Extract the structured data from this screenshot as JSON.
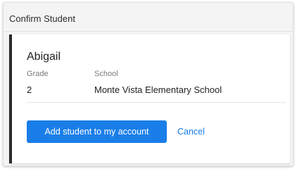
{
  "dialog": {
    "title": "Confirm Student"
  },
  "student": {
    "name": "Abigail",
    "grade_label": "Grade",
    "grade_value": "2",
    "school_label": "School",
    "school_value": "Monte Vista Elementary School"
  },
  "actions": {
    "add_label": "Add student to my account",
    "cancel_label": "Cancel"
  },
  "colors": {
    "accent": "#1a7ee8",
    "card_border": "#2a2a2a"
  }
}
